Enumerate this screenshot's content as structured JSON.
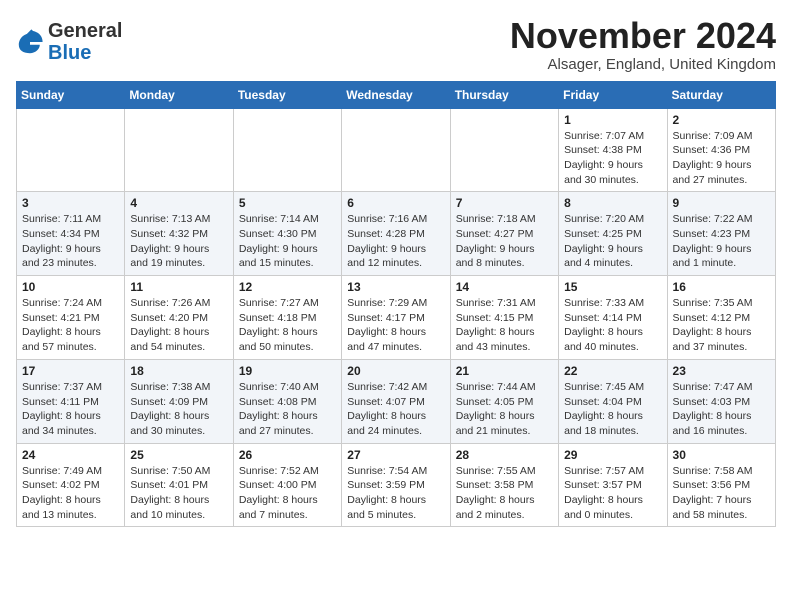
{
  "header": {
    "logo_general": "General",
    "logo_blue": "Blue",
    "title": "November 2024",
    "location": "Alsager, England, United Kingdom"
  },
  "weekdays": [
    "Sunday",
    "Monday",
    "Tuesday",
    "Wednesday",
    "Thursday",
    "Friday",
    "Saturday"
  ],
  "weeks": [
    [
      {
        "day": "",
        "info": ""
      },
      {
        "day": "",
        "info": ""
      },
      {
        "day": "",
        "info": ""
      },
      {
        "day": "",
        "info": ""
      },
      {
        "day": "",
        "info": ""
      },
      {
        "day": "1",
        "info": "Sunrise: 7:07 AM\nSunset: 4:38 PM\nDaylight: 9 hours and 30 minutes."
      },
      {
        "day": "2",
        "info": "Sunrise: 7:09 AM\nSunset: 4:36 PM\nDaylight: 9 hours and 27 minutes."
      }
    ],
    [
      {
        "day": "3",
        "info": "Sunrise: 7:11 AM\nSunset: 4:34 PM\nDaylight: 9 hours and 23 minutes."
      },
      {
        "day": "4",
        "info": "Sunrise: 7:13 AM\nSunset: 4:32 PM\nDaylight: 9 hours and 19 minutes."
      },
      {
        "day": "5",
        "info": "Sunrise: 7:14 AM\nSunset: 4:30 PM\nDaylight: 9 hours and 15 minutes."
      },
      {
        "day": "6",
        "info": "Sunrise: 7:16 AM\nSunset: 4:28 PM\nDaylight: 9 hours and 12 minutes."
      },
      {
        "day": "7",
        "info": "Sunrise: 7:18 AM\nSunset: 4:27 PM\nDaylight: 9 hours and 8 minutes."
      },
      {
        "day": "8",
        "info": "Sunrise: 7:20 AM\nSunset: 4:25 PM\nDaylight: 9 hours and 4 minutes."
      },
      {
        "day": "9",
        "info": "Sunrise: 7:22 AM\nSunset: 4:23 PM\nDaylight: 9 hours and 1 minute."
      }
    ],
    [
      {
        "day": "10",
        "info": "Sunrise: 7:24 AM\nSunset: 4:21 PM\nDaylight: 8 hours and 57 minutes."
      },
      {
        "day": "11",
        "info": "Sunrise: 7:26 AM\nSunset: 4:20 PM\nDaylight: 8 hours and 54 minutes."
      },
      {
        "day": "12",
        "info": "Sunrise: 7:27 AM\nSunset: 4:18 PM\nDaylight: 8 hours and 50 minutes."
      },
      {
        "day": "13",
        "info": "Sunrise: 7:29 AM\nSunset: 4:17 PM\nDaylight: 8 hours and 47 minutes."
      },
      {
        "day": "14",
        "info": "Sunrise: 7:31 AM\nSunset: 4:15 PM\nDaylight: 8 hours and 43 minutes."
      },
      {
        "day": "15",
        "info": "Sunrise: 7:33 AM\nSunset: 4:14 PM\nDaylight: 8 hours and 40 minutes."
      },
      {
        "day": "16",
        "info": "Sunrise: 7:35 AM\nSunset: 4:12 PM\nDaylight: 8 hours and 37 minutes."
      }
    ],
    [
      {
        "day": "17",
        "info": "Sunrise: 7:37 AM\nSunset: 4:11 PM\nDaylight: 8 hours and 34 minutes."
      },
      {
        "day": "18",
        "info": "Sunrise: 7:38 AM\nSunset: 4:09 PM\nDaylight: 8 hours and 30 minutes."
      },
      {
        "day": "19",
        "info": "Sunrise: 7:40 AM\nSunset: 4:08 PM\nDaylight: 8 hours and 27 minutes."
      },
      {
        "day": "20",
        "info": "Sunrise: 7:42 AM\nSunset: 4:07 PM\nDaylight: 8 hours and 24 minutes."
      },
      {
        "day": "21",
        "info": "Sunrise: 7:44 AM\nSunset: 4:05 PM\nDaylight: 8 hours and 21 minutes."
      },
      {
        "day": "22",
        "info": "Sunrise: 7:45 AM\nSunset: 4:04 PM\nDaylight: 8 hours and 18 minutes."
      },
      {
        "day": "23",
        "info": "Sunrise: 7:47 AM\nSunset: 4:03 PM\nDaylight: 8 hours and 16 minutes."
      }
    ],
    [
      {
        "day": "24",
        "info": "Sunrise: 7:49 AM\nSunset: 4:02 PM\nDaylight: 8 hours and 13 minutes."
      },
      {
        "day": "25",
        "info": "Sunrise: 7:50 AM\nSunset: 4:01 PM\nDaylight: 8 hours and 10 minutes."
      },
      {
        "day": "26",
        "info": "Sunrise: 7:52 AM\nSunset: 4:00 PM\nDaylight: 8 hours and 7 minutes."
      },
      {
        "day": "27",
        "info": "Sunrise: 7:54 AM\nSunset: 3:59 PM\nDaylight: 8 hours and 5 minutes."
      },
      {
        "day": "28",
        "info": "Sunrise: 7:55 AM\nSunset: 3:58 PM\nDaylight: 8 hours and 2 minutes."
      },
      {
        "day": "29",
        "info": "Sunrise: 7:57 AM\nSunset: 3:57 PM\nDaylight: 8 hours and 0 minutes."
      },
      {
        "day": "30",
        "info": "Sunrise: 7:58 AM\nSunset: 3:56 PM\nDaylight: 7 hours and 58 minutes."
      }
    ]
  ]
}
